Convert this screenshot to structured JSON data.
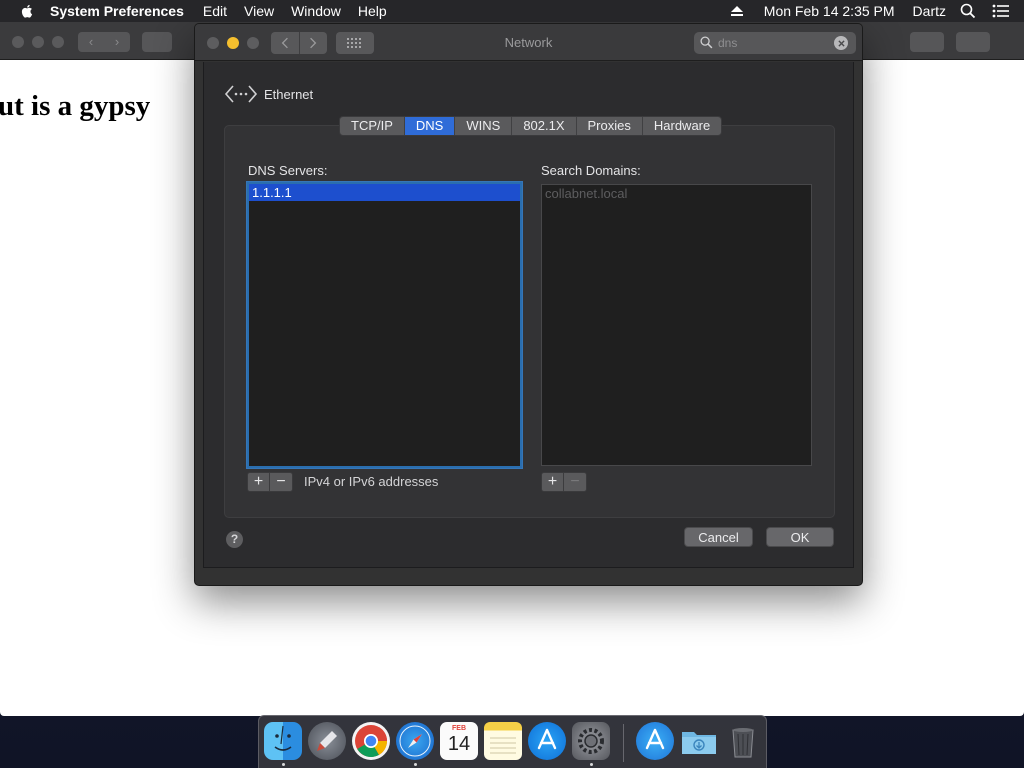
{
  "menubar": {
    "app_name": "System Preferences",
    "menus": [
      "Edit",
      "View",
      "Window",
      "Help"
    ],
    "clock": "Mon Feb 14  2:35 PM",
    "user": "Dartz"
  },
  "background_window": {
    "page_text": "ut is a gypsy"
  },
  "network_window": {
    "title": "Network",
    "search": {
      "value": "dns",
      "placeholder": "Search"
    },
    "interface_name": "Ethernet",
    "tabs": [
      {
        "label": "TCP/IP",
        "active": false
      },
      {
        "label": "DNS",
        "active": true
      },
      {
        "label": "WINS",
        "active": false
      },
      {
        "label": "802.1X",
        "active": false
      },
      {
        "label": "Proxies",
        "active": false
      },
      {
        "label": "Hardware",
        "active": false
      }
    ],
    "dns_servers": {
      "label": "DNS Servers:",
      "items": [
        "1.1.1.1"
      ],
      "hint": "IPv4 or IPv6 addresses"
    },
    "search_domains": {
      "label": "Search Domains:",
      "items": [
        "collabnet.local"
      ]
    },
    "buttons": {
      "help": "?",
      "cancel": "Cancel",
      "ok": "OK"
    }
  },
  "dock": {
    "items": [
      {
        "name": "finder-icon",
        "running": true
      },
      {
        "name": "launchpad-icon",
        "running": false
      },
      {
        "name": "chrome-icon",
        "running": false
      },
      {
        "name": "safari-icon",
        "running": true
      },
      {
        "name": "calendar-icon",
        "running": false
      },
      {
        "name": "notes-icon",
        "running": false
      },
      {
        "name": "app-store-icon",
        "running": false
      },
      {
        "name": "system-preferences-icon",
        "running": true
      },
      {
        "name": "applications-folder-icon",
        "running": false
      },
      {
        "name": "downloads-folder-icon",
        "running": false
      },
      {
        "name": "trash-icon",
        "running": false
      }
    ],
    "calendar_month": "FEB",
    "calendar_day": "14"
  }
}
